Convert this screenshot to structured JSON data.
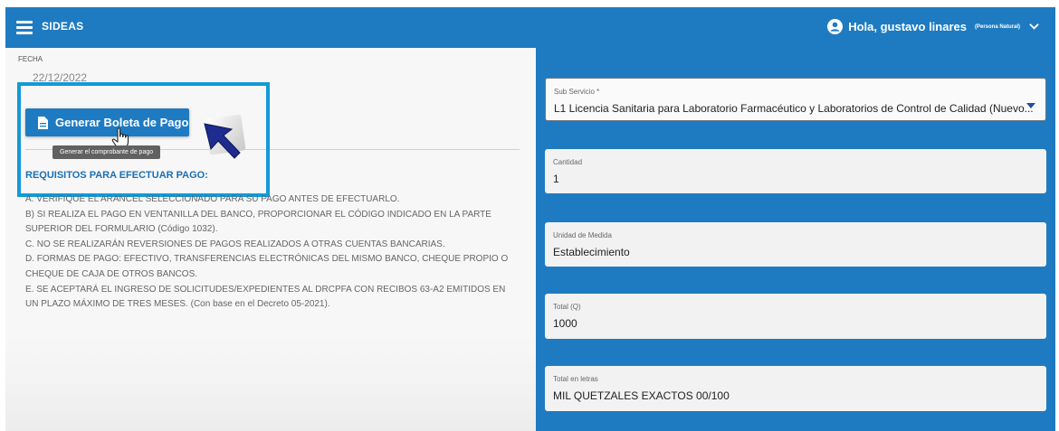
{
  "header": {
    "brand": "SIDEAS",
    "greeting": "Hola, gustavo linares",
    "user_type": "(Persona Natural)"
  },
  "form_left": {
    "fecha_label": "FECHA",
    "fecha_value": "22/12/2022",
    "generate_button": "Generar Boleta de Pago",
    "tooltip": "Generar el comprobante de pago",
    "requirements_title": "REQUISITOS PARA EFECTUAR PAGO:",
    "requirements": [
      "A. VERIFIQUE EL ARANCEL SELECCIONADO PARA SU PAGO ANTES DE EFECTUARLO.",
      "B) SI REALIZA EL PAGO EN VENTANILLA DEL BANCO, PROPORCIONAR EL CÓDIGO INDICADO EN LA PARTE SUPERIOR DEL FORMULARIO (Código 1032).",
      "C. NO SE REALIZARÁN REVERSIONES DE PAGOS REALIZADOS A OTRAS CUENTAS BANCARIAS.",
      "D. FORMAS DE PAGO: EFECTIVO, TRANSFERENCIAS ELECTRÓNICAS DEL MISMO BANCO, CHEQUE PROPIO O CHEQUE DE CAJA DE OTROS BANCOS.",
      "E. SE ACEPTARÁ EL INGRESO DE SOLICITUDES/EXPEDIENTES AL DRCPFA CON RECIBOS 63-A2 EMITIDOS EN UN PLAZO MÁXIMO DE TRES MESES. (Con base en el Decreto 05-2021)."
    ]
  },
  "form_right": {
    "sub_servicio": {
      "label": "Sub Servicio *",
      "value": "L1 Licencia Sanitaria para Laboratorio Farmacéutico y Laboratorios de Control de Calidad (Nuevo..."
    },
    "cantidad": {
      "label": "Cantidad",
      "value": "1"
    },
    "unidad": {
      "label": "Unidad de Medida",
      "value": "Establecimiento"
    },
    "total": {
      "label": "Total (Q)",
      "value": "1000"
    },
    "total_letras": {
      "label": "Total en letras",
      "value": "MIL QUETZALES EXACTOS 00/100"
    }
  },
  "colors": {
    "primary": "#1f7bc1",
    "highlight_frame": "#139ad6",
    "requirements_title": "#1a6fb5"
  },
  "icons": [
    "menu-icon",
    "user-icon",
    "chevron-down-icon",
    "document-icon",
    "hand-cursor-icon",
    "pointer-arrow-icon",
    "dropdown-caret-icon"
  ]
}
